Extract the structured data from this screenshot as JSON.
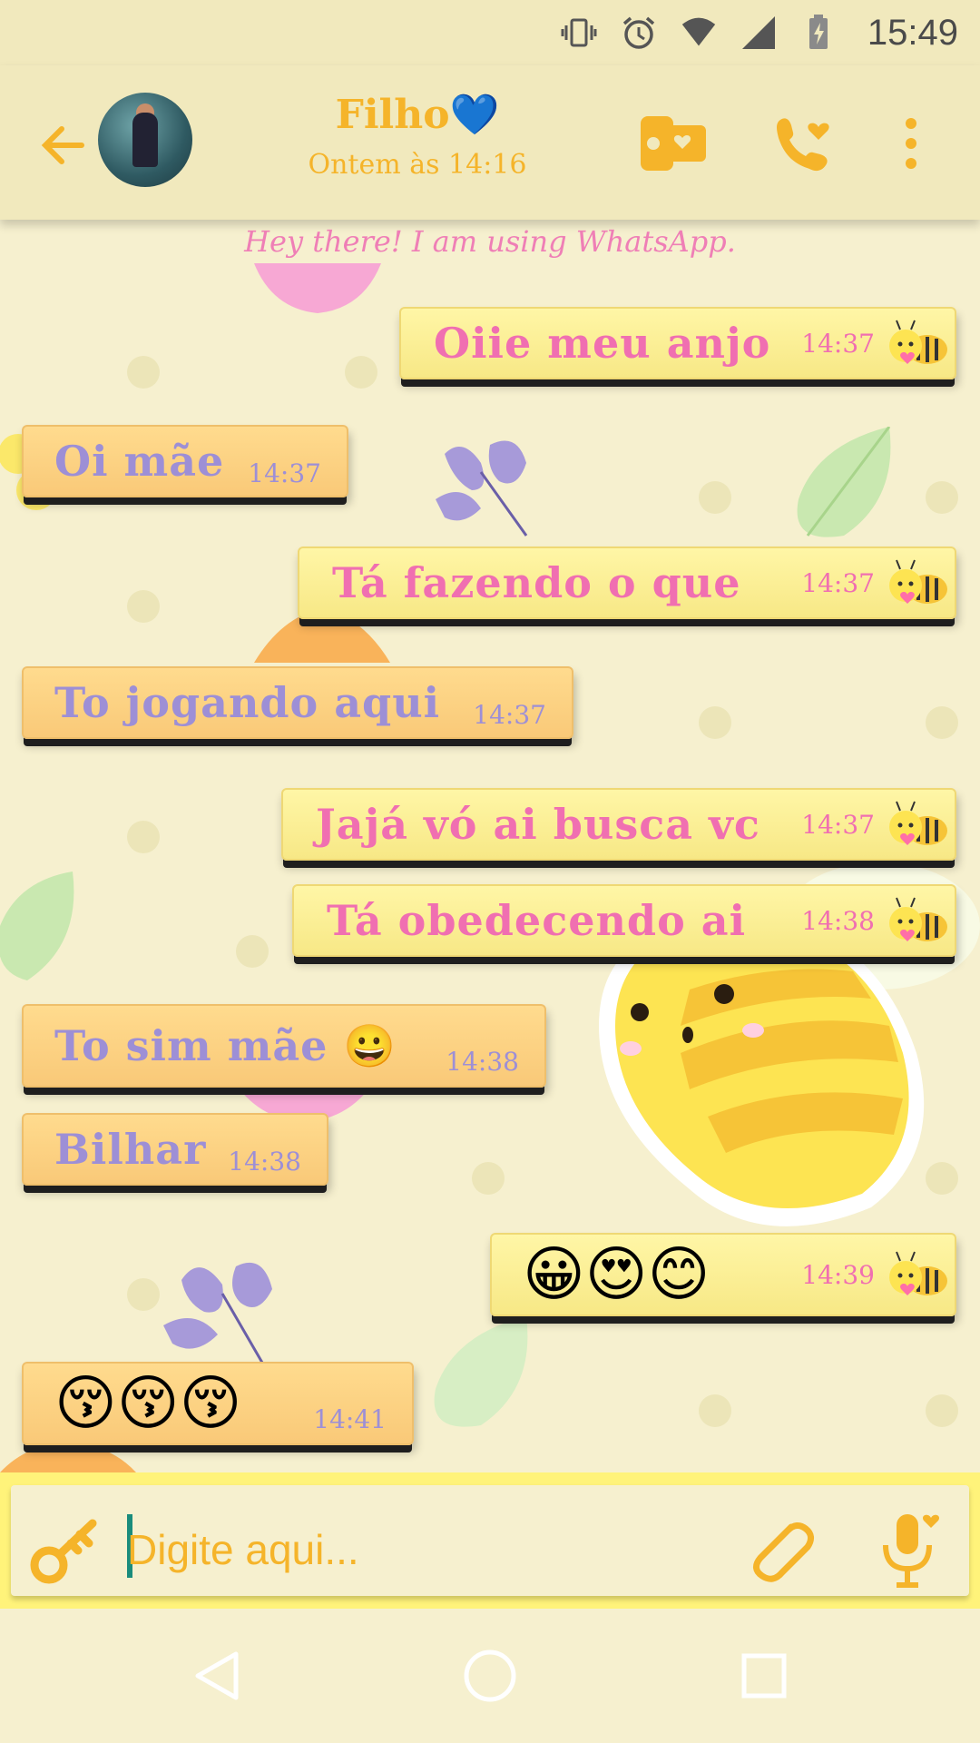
{
  "status_bar": {
    "time": "15:49"
  },
  "header": {
    "contact_name": "Filho💙",
    "last_seen": "Ontem às 14:16",
    "status_banner": "Hey there! I am using WhatsApp."
  },
  "messages": [
    {
      "dir": "out",
      "text": "Oiie meu anjo",
      "time": "14:37"
    },
    {
      "dir": "in",
      "text": "Oi mãe",
      "time": "14:37"
    },
    {
      "dir": "out",
      "text": "Tá fazendo o que",
      "time": "14:37"
    },
    {
      "dir": "in",
      "text": "To jogando aqui",
      "time": "14:37"
    },
    {
      "dir": "out",
      "text": "Jajá vó ai busca vc",
      "time": "14:37"
    },
    {
      "dir": "out",
      "text": "Tá obedecendo ai",
      "time": "14:38"
    },
    {
      "dir": "in",
      "text": "To sim mãe 😀",
      "time": "14:38"
    },
    {
      "dir": "in",
      "text": "Bilhar",
      "time": "14:38"
    },
    {
      "dir": "out",
      "text": "😀😍😊",
      "time": "14:39"
    },
    {
      "dir": "in",
      "text": "😚😚😚",
      "time": "14:41"
    }
  ],
  "composer": {
    "placeholder": "Digite aqui..."
  },
  "icons": {
    "back": "arrow-left-icon",
    "video": "video-call-icon",
    "call": "phone-heart-icon",
    "menu": "more-vert-icon",
    "key": "key-icon",
    "attach": "paperclip-icon",
    "mic": "microphone-icon",
    "tick": "bee-tick-icon"
  },
  "colors": {
    "accent": "#f5b42a",
    "out_text": "#f06fb1",
    "in_text": "#9d8fd6"
  }
}
